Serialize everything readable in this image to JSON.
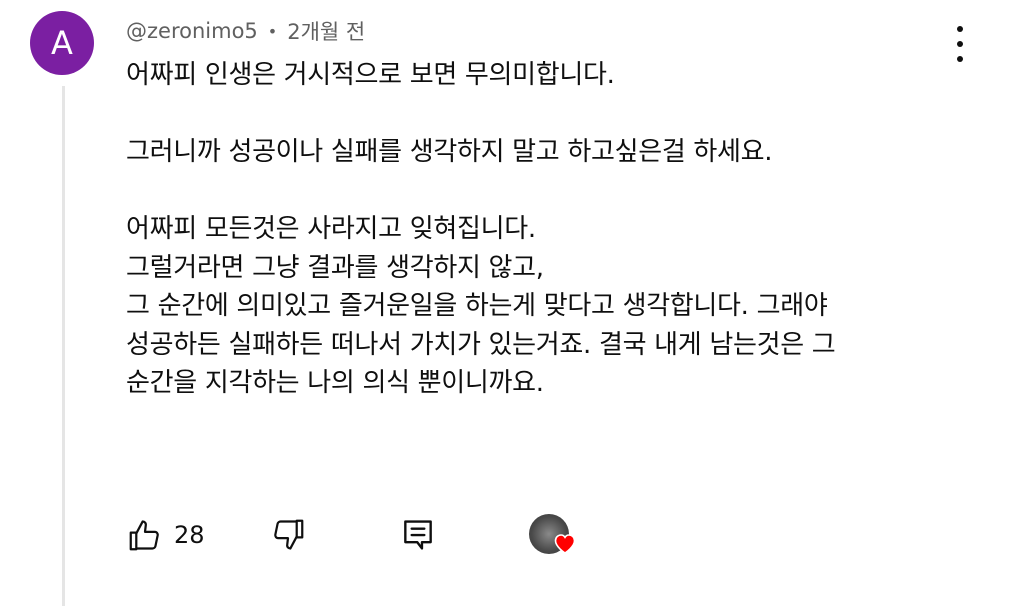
{
  "comment": {
    "avatar_letter": "A",
    "avatar_color": "#7b1fa2",
    "author": "@zeronimo5",
    "separator": "•",
    "timestamp": "2개월 전",
    "lines": [
      "어짜피 인생은 거시적으로 보면 무의미합니다.",
      "",
      "그러니까 성공이나 실패를 생각하지 말고 하고싶은걸 하세요.",
      "",
      "어짜피 모든것은 사라지고 잊혀집니다.",
      "그럴거라면 그냥 결과를 생각하지 않고,",
      "그 순간에 의미있고 즐거운일을 하는게 맞다고 생각합니다. 그래야",
      "성공하든 실패하든 떠나서 가치가 있는거죠. 결국 내게 남는것은 그",
      "순간을 지각하는 나의 의식 뿐이니까요."
    ]
  },
  "actions": {
    "like_count": "28",
    "like_icon": "thumbs-up-icon",
    "dislike_icon": "thumbs-down-icon",
    "reply_icon": "reply-comment-icon",
    "creator_heart_icon": "creator-heart-icon",
    "heart_color": "#ff0000"
  },
  "menu_icon": "more-vertical-icon"
}
